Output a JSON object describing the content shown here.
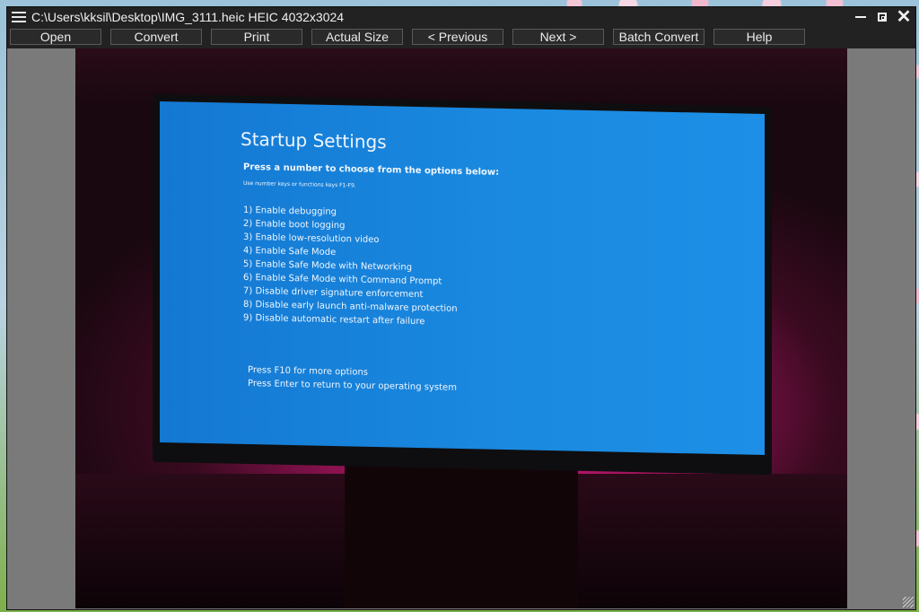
{
  "window": {
    "title": "C:\\Users\\kksil\\Desktop\\IMG_3111.heic HEIC 4032x3024",
    "controls": [
      "minimize",
      "restore",
      "close"
    ]
  },
  "toolbar": {
    "buttons": [
      {
        "label": "Open"
      },
      {
        "label": "Convert"
      },
      {
        "label": "Print"
      },
      {
        "label": "Actual Size"
      },
      {
        "label": "< Previous"
      },
      {
        "label": "Next >"
      },
      {
        "label": "Batch Convert"
      },
      {
        "label": "Help"
      }
    ]
  },
  "image": {
    "screen_title": "Startup Settings",
    "screen_subtitle": "Press a number to choose from the options below:",
    "screen_hint": "Use number keys or functions keys F1-F9.",
    "options": [
      "1) Enable debugging",
      "2) Enable boot logging",
      "3) Enable low-resolution video",
      "4) Enable Safe Mode",
      "5) Enable Safe Mode with Networking",
      "6) Enable Safe Mode with Command Prompt",
      "7) Disable driver signature enforcement",
      "8) Disable early launch anti-malware protection",
      "9) Disable automatic restart after failure"
    ],
    "footer": [
      "Press F10 for more options",
      "Press Enter to return to your operating system"
    ]
  }
}
